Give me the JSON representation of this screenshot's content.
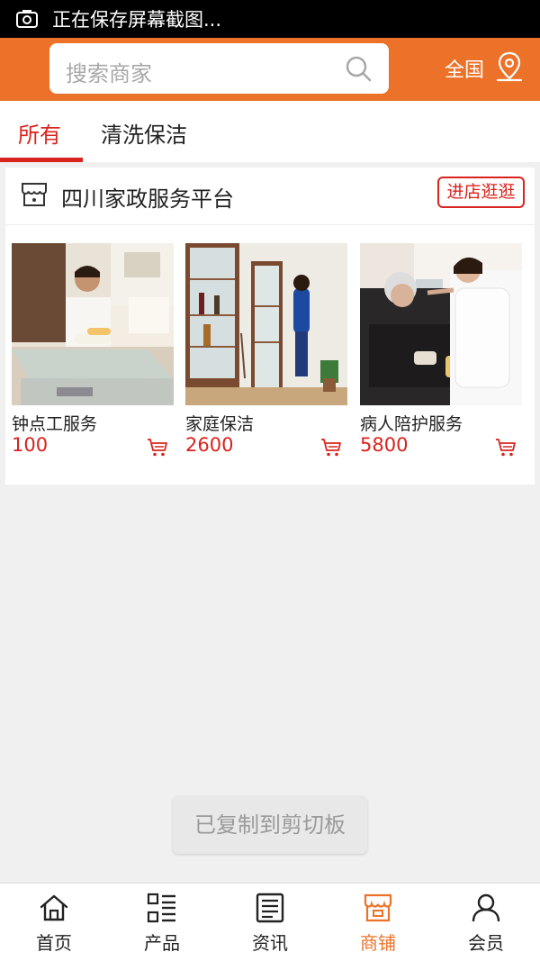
{
  "status_bar": {
    "text": "正在保存屏幕截图...",
    "icon": "screenshot-icon"
  },
  "search": {
    "placeholder": "搜索商家",
    "icon": "search-icon"
  },
  "region": {
    "label": "全国",
    "icon": "location-pin-icon"
  },
  "tabs": [
    {
      "label": "所有",
      "active": true
    },
    {
      "label": "清洗保洁",
      "active": false
    }
  ],
  "store": {
    "name": "四川家政服务平台",
    "icon": "store-icon",
    "visit_label": "进店逛逛"
  },
  "products": [
    {
      "name": "钟点工服务",
      "price": "100",
      "image": "housekeeper-cleaning-table-photo"
    },
    {
      "name": "家庭保洁",
      "price": "2600",
      "image": "cleaning-cabinet-photo"
    },
    {
      "name": "病人陪护服务",
      "price": "5800",
      "image": "nurse-feeding-elder-photo"
    }
  ],
  "toast": "已复制到剪切板",
  "bottom_nav": [
    {
      "label": "首页",
      "icon": "home-icon",
      "active": false
    },
    {
      "label": "产品",
      "icon": "product-list-icon",
      "active": false
    },
    {
      "label": "资讯",
      "icon": "news-icon",
      "active": false
    },
    {
      "label": "商铺",
      "icon": "shop-icon",
      "active": true
    },
    {
      "label": "会员",
      "icon": "member-icon",
      "active": false
    }
  ],
  "colors": {
    "brand_orange": "#ec7229",
    "accent_red": "#d9231d"
  }
}
